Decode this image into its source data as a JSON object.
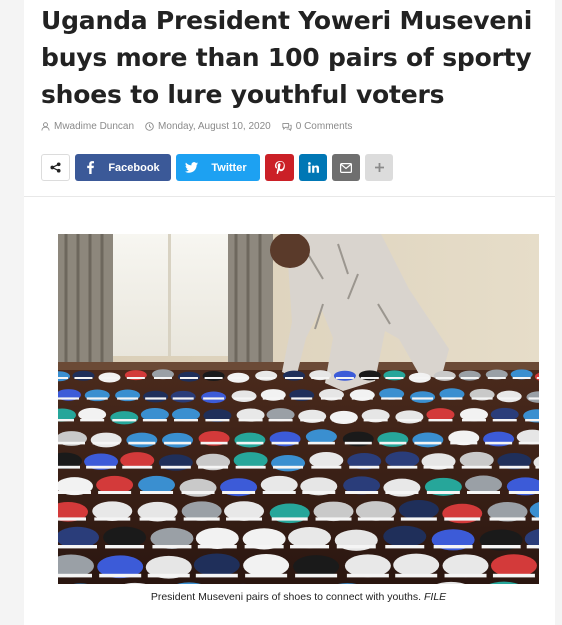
{
  "article": {
    "title": "Uganda President Yoweri Museveni buys more than 100 pairs of sporty shoes to lure youthful voters",
    "author": "Mwadime Duncan",
    "date": "Monday, August 10, 2020",
    "comments": "0 Comments"
  },
  "share": {
    "facebook_label": "Facebook",
    "twitter_label": "Twitter",
    "icons": [
      "share-icon",
      "facebook-icon",
      "twitter-icon",
      "pinterest-icon",
      "linkedin-icon",
      "mail-icon",
      "plus-icon"
    ]
  },
  "image": {
    "caption": "President Museveni pairs of shoes to connect with youths.",
    "caption_credit": "FILE"
  },
  "colors": {
    "facebook": "#3b5998",
    "twitter": "#1da1f2",
    "pinterest": "#cb2027",
    "linkedin": "#0077b5",
    "mail": "#6f6f6f"
  }
}
